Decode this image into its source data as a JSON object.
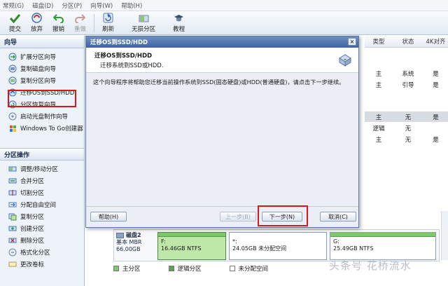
{
  "menu": [
    "常规(G)",
    "磁盘(D)",
    "分区(P)",
    "向导(W)",
    "帮助(H)"
  ],
  "toolbar": {
    "apply": "提交",
    "discard": "放弃",
    "undo": "撤销",
    "redo": "重做",
    "refresh": "刷新",
    "lossless": "无损分区",
    "tutorial": "教程"
  },
  "wizard_panel": {
    "title": "向导",
    "items": [
      "扩展分区向导",
      "复制磁盘向导",
      "复制分区向导",
      "迁移OS到SSD/HDD",
      "分区恢复向导",
      "启动光盘制作向导",
      "Windows To Go创建器"
    ]
  },
  "ops_panel": {
    "title": "分区操作",
    "items": [
      "调整/移动分区",
      "合并分区",
      "切割分区",
      "分配自由空间",
      "复制分区",
      "创建分区",
      "删除分区",
      "格式化分区",
      "更改卷标"
    ]
  },
  "table": {
    "headers": [
      "类型",
      "状态",
      "4K对齐"
    ],
    "rows": [
      [
        "主",
        "系统",
        "是"
      ],
      [
        "主",
        "引导",
        "是"
      ],
      [
        "主",
        "无",
        "是"
      ],
      [
        "逻辑",
        "无",
        ""
      ],
      [
        "主",
        "无",
        "是"
      ]
    ]
  },
  "disk": {
    "name": "磁盘2",
    "type": "基本 MBR",
    "size": "66.00GB",
    "partitions": [
      {
        "letter": "F:",
        "desc": "16.46GB NTFS"
      },
      {
        "letter": "*:",
        "desc": "24.05GB 未分配空间"
      },
      {
        "letter": "G:",
        "desc": "25.49GB NTFS"
      }
    ]
  },
  "legend": [
    "主分区",
    "逻辑分区",
    "未分配空间"
  ],
  "dialog": {
    "title": "迁移OS到SSD/HDD",
    "header_title": "迁移OS到SSD/HDD",
    "header_sub": "迁移系统到SSD或HDD.",
    "body": "这个向导程序将帮助您迁移当前操作系统到SSD(固态硬盘)或HDD(普通硬盘)，请点击下一步继续。",
    "help": "帮助(H)",
    "back": "上一步(B)",
    "next": "下一步(N)",
    "cancel": "取消(C)",
    "close": "×"
  },
  "watermark": "头条号 花桥流水",
  "colors": {
    "accent_red": "#d9171a",
    "title_blue": "#3e64a0",
    "primary_green": "#7fc76d"
  }
}
